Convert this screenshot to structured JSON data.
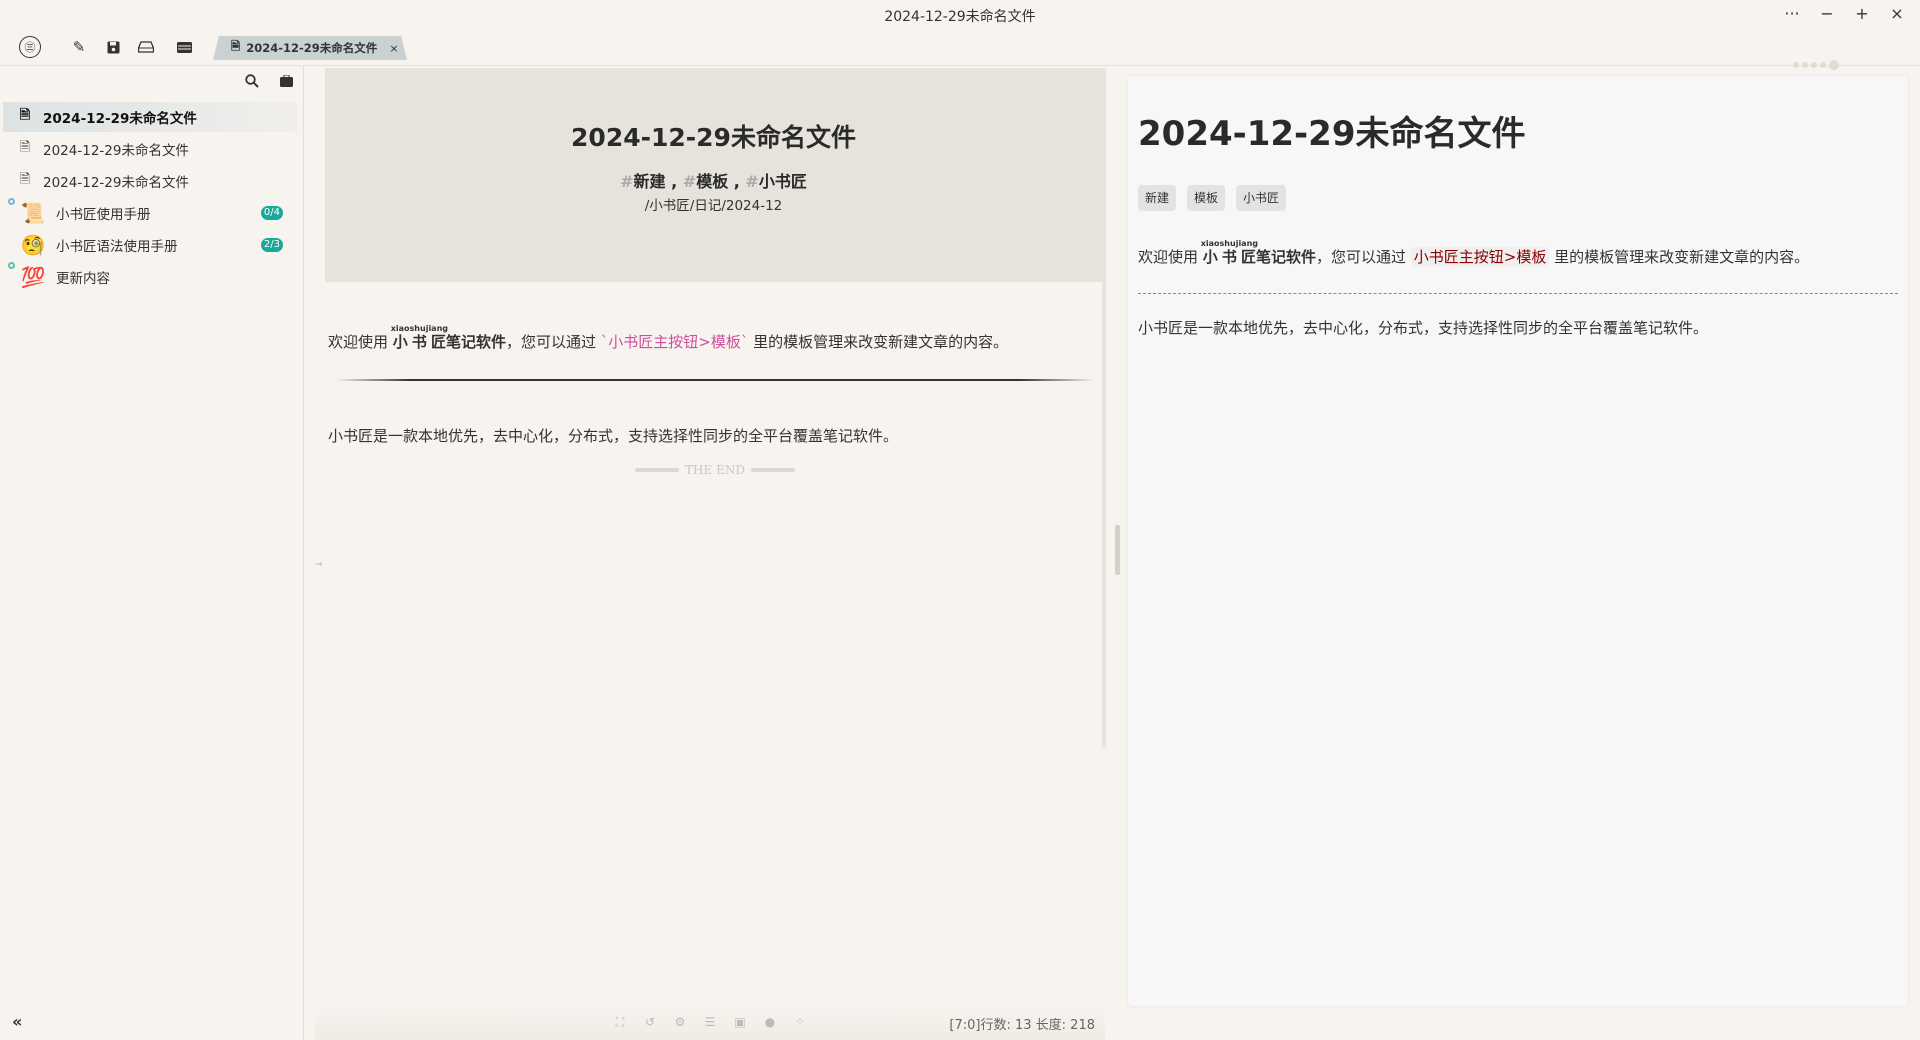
{
  "window": {
    "title": "2024-12-29未命名文件",
    "more": "···",
    "minimize": "−",
    "maximize": "+",
    "close": "×"
  },
  "toolbar": {
    "logo": "㊂",
    "icons": [
      "edit-icon",
      "save-icon",
      "drive-icon",
      "panel-icon"
    ]
  },
  "tab": {
    "label": "2024-12-29未命名文件",
    "close": "×"
  },
  "sidebar": {
    "items": [
      {
        "label": "2024-12-29未命名文件",
        "icon": "file-icon",
        "active": true
      },
      {
        "label": "2024-12-29未命名文件",
        "icon": "file-icon"
      },
      {
        "label": "2024-12-29未命名文件",
        "icon": "file-icon"
      },
      {
        "label": "小书匠使用手册",
        "icon": "scroll-emoji",
        "emoji": "📜",
        "badge": "0/4"
      },
      {
        "label": "小书匠语法使用手册",
        "icon": "monocle-face-emoji",
        "emoji": "🧐",
        "badge": "2/3"
      },
      {
        "label": "更新内容",
        "icon": "hundred-points-emoji",
        "emoji": "💯"
      }
    ],
    "collapse": "«"
  },
  "editor": {
    "title": "2024-12-29未命名文件",
    "tags": [
      "新建",
      "模板",
      "小书匠"
    ],
    "tag_hash": "#",
    "tag_sep": " , ",
    "path": "/小书匠/日记/2024-12",
    "para1": {
      "before": "欢迎使用 ",
      "ruby_base": "小书匠",
      "ruby_text": "xiaoshujiang",
      "bold_rest": "笔记软件",
      "middle": "，您可以通过 ",
      "code": "`小书匠主按钮>模板`",
      "after": " 里的模板管理来改变新建文章的内容。"
    },
    "para2": "小书匠是一款本地优先，去中心化，分布式，支持选择性同步的全平台覆盖笔记软件。",
    "the_end": "THE END",
    "status": "[7:0]行数: 13 长度: 218"
  },
  "preview": {
    "title": "2024-12-29未命名文件",
    "tags": [
      "新建",
      "模板",
      "小书匠"
    ],
    "code": "小书匠主按钮>模板"
  }
}
